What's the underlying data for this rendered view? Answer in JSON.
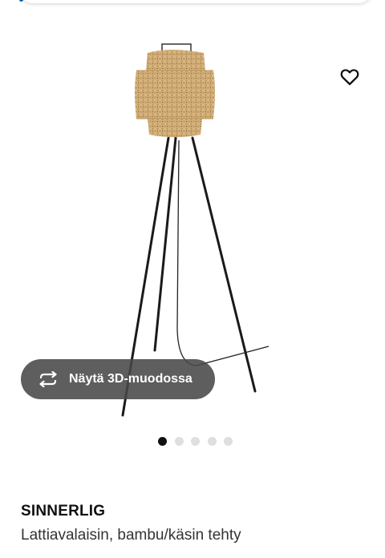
{
  "view3d": {
    "label": "Näytä 3D-muodossa",
    "icon": "rotate-3d-icon"
  },
  "favourite": {
    "icon": "heart-outline-icon"
  },
  "gallery": {
    "image_count": 5,
    "active_index": 0
  },
  "product": {
    "name": "SINNERLIG",
    "description": "Lattiavalaisin, bambu/käsin tehty"
  },
  "colors": {
    "accent": "#0058a3",
    "button_bg": "#484848",
    "bamboo": "#d8b57e",
    "legs": "#1a1a1a"
  }
}
